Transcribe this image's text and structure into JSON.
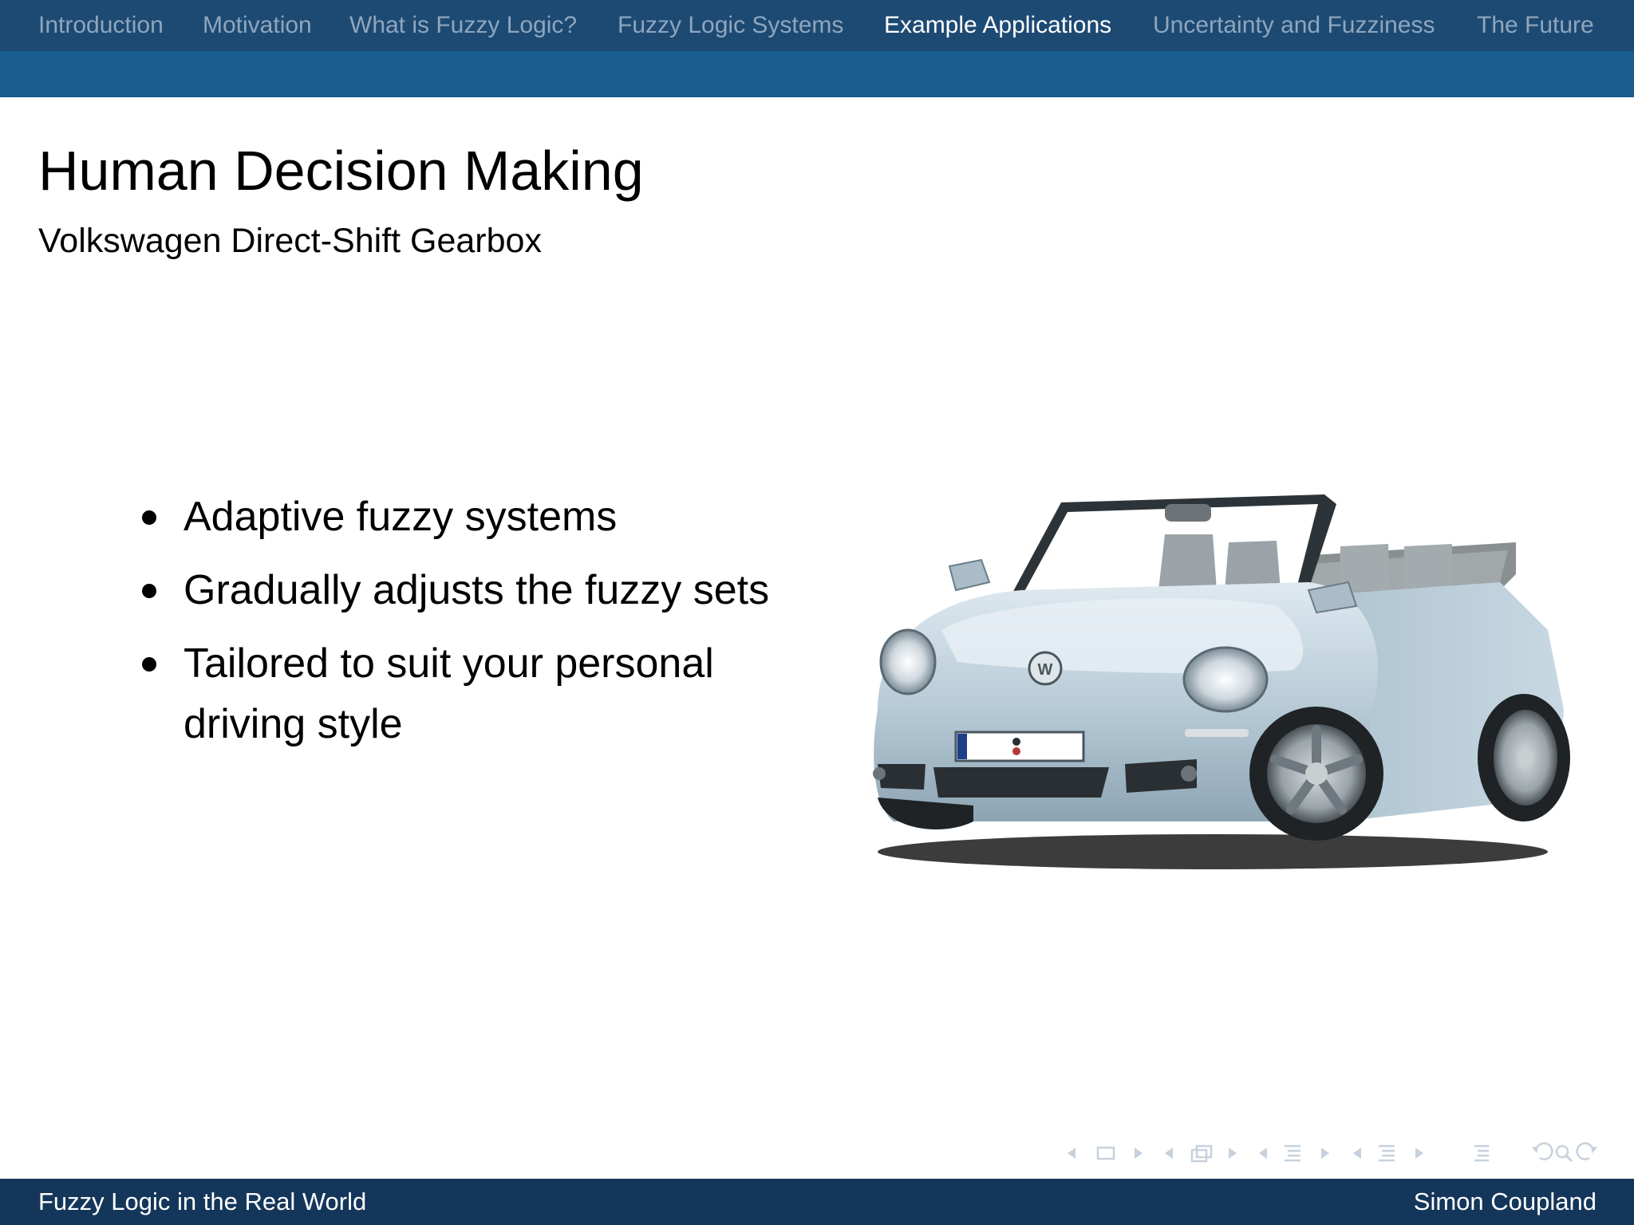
{
  "nav": {
    "items": [
      {
        "label": "Introduction",
        "active": false
      },
      {
        "label": "Motivation",
        "active": false
      },
      {
        "label": "What is Fuzzy Logic?",
        "active": false
      },
      {
        "label": "Fuzzy Logic Systems",
        "active": false
      },
      {
        "label": "Example Applications",
        "active": true
      },
      {
        "label": "Uncertainty and Fuzziness",
        "active": false
      },
      {
        "label": "The Future",
        "active": false
      }
    ]
  },
  "slide": {
    "title": "Human Decision Making",
    "subtitle": "Volkswagen Direct-Shift Gearbox",
    "bullets": [
      "Adaptive fuzzy systems",
      "Gradually adjusts the fuzzy sets",
      "Tailored to suit your personal driving style"
    ],
    "image": {
      "subject": "Volkswagen New Beetle Cabriolet, light blue, front three-quarter view"
    }
  },
  "footer": {
    "left": "Fuzzy Logic in the Real World",
    "right": "Simon Coupland"
  },
  "colors": {
    "nav_bg": "#1d4a73",
    "nav_strip": "#1a5d8f",
    "nav_inactive": "#8ea6bd",
    "nav_active": "#ffffff",
    "footer_bg": "#14365a",
    "text": "#000000"
  },
  "navigation_symbols": [
    "prev-slide-icon",
    "slide-icon",
    "next-slide-icon",
    "prev-frame-icon",
    "frame-icon",
    "next-frame-icon",
    "prev-subsection-icon",
    "subsection-icon",
    "next-subsection-icon",
    "prev-section-icon",
    "section-icon",
    "next-section-icon",
    "outline-icon",
    "back-icon",
    "search-icon",
    "forward-icon"
  ]
}
